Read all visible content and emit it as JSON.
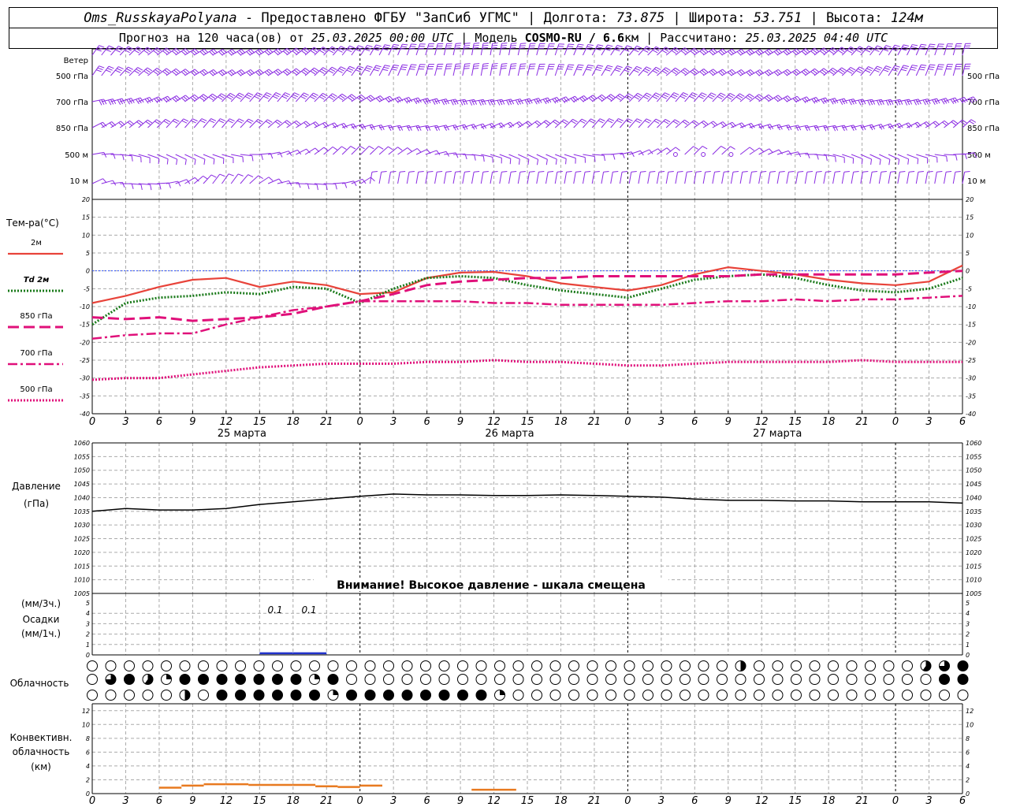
{
  "header": {
    "station": "Oms_RusskayaPolyana",
    "provider": "Предоставлено ФГБУ \"ЗапСиб УГМС\"",
    "lon_label": "Долгота:",
    "lon_value": "73.875",
    "lat_label": "Широта:",
    "lat_value": "53.751",
    "alt_label": "Высота:",
    "alt_value": "124м",
    "forecast_label": "Прогноз на 120 часа(ов) от",
    "forecast_start": "25.03.2025 00:00 UTC",
    "model_label": "Модель",
    "model_name": "COSMO-RU / 6.6",
    "model_unit": "км",
    "computed_label": "Рассчитано:",
    "computed_value": "25.03.2025 04:40 UTC"
  },
  "x_ticks": [
    "0",
    "3",
    "6",
    "9",
    "12",
    "15",
    "18",
    "21",
    "0",
    "3",
    "6",
    "9",
    "12",
    "15",
    "18",
    "21",
    "0",
    "3",
    "6",
    "9",
    "12",
    "15",
    "18",
    "21",
    "0",
    "3",
    "6"
  ],
  "day_labels": [
    "25 марта",
    "26 марта",
    "27 марта"
  ],
  "wind_panel": {
    "levels": [
      "Ветер",
      "500 гПа",
      "700 гПа",
      "850 гПа",
      "500 м",
      "10  м"
    ],
    "right_levels": [
      "500 гПа",
      "700 гПа",
      "850 гПа",
      "500 м",
      "10  м"
    ]
  },
  "temp_panel": {
    "ylabel": "Тем-ра(°C)",
    "legend": [
      "2м",
      "Td  2м",
      "850 гПа",
      "700 гПа",
      "500 гПа"
    ],
    "y_ticks": [
      20,
      15,
      10,
      5,
      0,
      -5,
      -10,
      -15,
      -20,
      -25,
      -30,
      -35,
      -40
    ]
  },
  "pressure_panel": {
    "ylabel1": "Давление",
    "ylabel2": "(гПа)",
    "y_ticks": [
      1060,
      1055,
      1050,
      1045,
      1040,
      1035,
      1030,
      1025,
      1020,
      1015,
      1010,
      1005
    ],
    "warning": "Внимание! Высокое давление - шкала смещена"
  },
  "precip_panel": {
    "labels": [
      "(мм/3ч.)",
      "Осадки",
      "(мм/1ч.)"
    ],
    "y_ticks": [
      5,
      4,
      3,
      2,
      1,
      0
    ],
    "annotations": [
      "0.1",
      "0.1"
    ]
  },
  "cloud_panel": {
    "label": "Облачность"
  },
  "conv_panel": {
    "labels": [
      "Конвективн.",
      "облачность",
      "(км)"
    ],
    "y_ticks": [
      12,
      10,
      8,
      6,
      4,
      2,
      0
    ]
  },
  "colors": {
    "wind": "#8a2be2",
    "t2m": "#e8433a",
    "td2m": "#1a7a1a",
    "t850": "#e0107a",
    "t700": "#e0107a",
    "t500": "#e0107a",
    "zero": "#3355ff",
    "precip": "#2233cc",
    "conv": "#e87a20",
    "pressure": "#000000"
  },
  "chart_data": [
    {
      "type": "line",
      "name": "temperature",
      "ylabel": "Тем-ра(°C)",
      "ylim": [
        -40,
        20
      ],
      "x": [
        0,
        3,
        6,
        9,
        12,
        15,
        18,
        21,
        24,
        27,
        30,
        33,
        36,
        39,
        42,
        45,
        48,
        51,
        54,
        57,
        60,
        63,
        66,
        69,
        72,
        75,
        78
      ],
      "series": [
        {
          "name": "2м",
          "values": [
            -9,
            -7,
            -4.5,
            -2.5,
            -2,
            -4.5,
            -3,
            -4,
            -6.5,
            -6,
            -2,
            -0.5,
            -0.3,
            -1.5,
            -3.5,
            -4.5,
            -5.5,
            -4,
            -1,
            1,
            0,
            -1,
            -2.5,
            -3.5,
            -4,
            -3,
            1.5
          ]
        },
        {
          "name": "Td  2м",
          "values": [
            -15,
            -9,
            -7.5,
            -7,
            -6,
            -6.5,
            -4.5,
            -5,
            -9,
            -5,
            -2,
            -1.5,
            -2,
            -4,
            -5.5,
            -6.5,
            -7.5,
            -5,
            -2.5,
            -1.5,
            -1,
            -2,
            -4,
            -5.5,
            -6,
            -5,
            -2
          ]
        },
        {
          "name": "850 гПа",
          "values": [
            -13,
            -13.5,
            -13,
            -14,
            -13.5,
            -13,
            -12,
            -10,
            -8.5,
            -6.5,
            -4,
            -3,
            -2.5,
            -2,
            -2,
            -1.5,
            -1.5,
            -1.5,
            -1.5,
            -1.5,
            -1,
            -1,
            -1,
            -1,
            -1,
            -0.5,
            0
          ]
        },
        {
          "name": "700 гПа",
          "values": [
            -19,
            -18,
            -17.5,
            -17.5,
            -15,
            -13,
            -11,
            -10,
            -8.5,
            -8.5,
            -8.5,
            -8.5,
            -9,
            -9,
            -9.5,
            -9.5,
            -9.5,
            -9.5,
            -9,
            -8.5,
            -8.5,
            -8,
            -8.5,
            -8,
            -8,
            -7.5,
            -7
          ]
        },
        {
          "name": "500 гПа",
          "values": [
            -30.5,
            -30,
            -30,
            -29,
            -28,
            -27,
            -26.5,
            -26,
            -26,
            -26,
            -25.5,
            -25.5,
            -25,
            -25.5,
            -25.5,
            -26,
            -26.5,
            -26.5,
            -26,
            -25.5,
            -25.5,
            -25.5,
            -25.5,
            -25,
            -25.5,
            -25.5,
            -25.5
          ]
        }
      ]
    },
    {
      "type": "line",
      "name": "pressure",
      "ylabel": "Давление (гПа)",
      "ylim": [
        1005,
        1060
      ],
      "x": [
        0,
        3,
        6,
        9,
        12,
        15,
        18,
        21,
        24,
        27,
        30,
        33,
        36,
        39,
        42,
        45,
        48,
        51,
        54,
        57,
        60,
        63,
        66,
        69,
        72,
        75,
        78
      ],
      "series": [
        {
          "name": "Давление",
          "values": [
            1035,
            1036,
            1035.5,
            1035.5,
            1036,
            1037.5,
            1038.5,
            1039.5,
            1040.5,
            1041.3,
            1041,
            1041,
            1040.8,
            1040.8,
            1041,
            1040.8,
            1040.5,
            1040.2,
            1039.5,
            1039,
            1039,
            1038.8,
            1038.8,
            1038.5,
            1038.5,
            1038.5,
            1038
          ]
        }
      ]
    },
    {
      "type": "bar",
      "name": "precipitation",
      "ylabel": "Осадки (мм/3ч.)",
      "ylim": [
        0,
        5
      ],
      "x": [
        16.5,
        19.5
      ],
      "values": [
        0.1,
        0.1
      ]
    },
    {
      "type": "bar",
      "name": "convective_cloud",
      "ylabel": "Конвективн. облачность (км)",
      "ylim": [
        0,
        13
      ],
      "x": [
        6,
        8,
        10,
        12,
        14,
        16,
        18,
        20,
        22,
        24,
        34,
        36
      ],
      "values": [
        1.0,
        1.3,
        1.5,
        1.5,
        1.4,
        1.4,
        1.4,
        1.2,
        1.1,
        1.3,
        0.7,
        0.7
      ]
    },
    {
      "type": "table",
      "name": "cloud_cover",
      "note": "fraction 0-1 per symbol, 3 layers, 48 symbols",
      "rows": [
        [
          0,
          0,
          0,
          0,
          0,
          0,
          0,
          0,
          0,
          0,
          0,
          0,
          0,
          0,
          0,
          0,
          0,
          0,
          0,
          0,
          0,
          0,
          0,
          0,
          0,
          0,
          0,
          0,
          0,
          0,
          0,
          0,
          0,
          0,
          0,
          0.5,
          0,
          0,
          0,
          0,
          0,
          0,
          0,
          0,
          0,
          0.6,
          0.75,
          1
        ],
        [
          0,
          0.75,
          1,
          0.6,
          0.25,
          1,
          1,
          1,
          1,
          1,
          1,
          1,
          0.25,
          1,
          0,
          0,
          0,
          0,
          0,
          0,
          0,
          0,
          0,
          0,
          0,
          0,
          0,
          0,
          0,
          0,
          0,
          0,
          0,
          0,
          0,
          0,
          0,
          0,
          0,
          0,
          0,
          0,
          0,
          0,
          0,
          0,
          1,
          1
        ],
        [
          0,
          0,
          0,
          0,
          0,
          0.5,
          0,
          1,
          1,
          1,
          1,
          1,
          1,
          0.25,
          1,
          1,
          1,
          1,
          1,
          1,
          1,
          1,
          0.25,
          0,
          0,
          0,
          0,
          0,
          0,
          0,
          0,
          0,
          0,
          0,
          0,
          0,
          0,
          0,
          0,
          0,
          0,
          0,
          0,
          0,
          0,
          0,
          0,
          0
        ]
      ]
    }
  ]
}
